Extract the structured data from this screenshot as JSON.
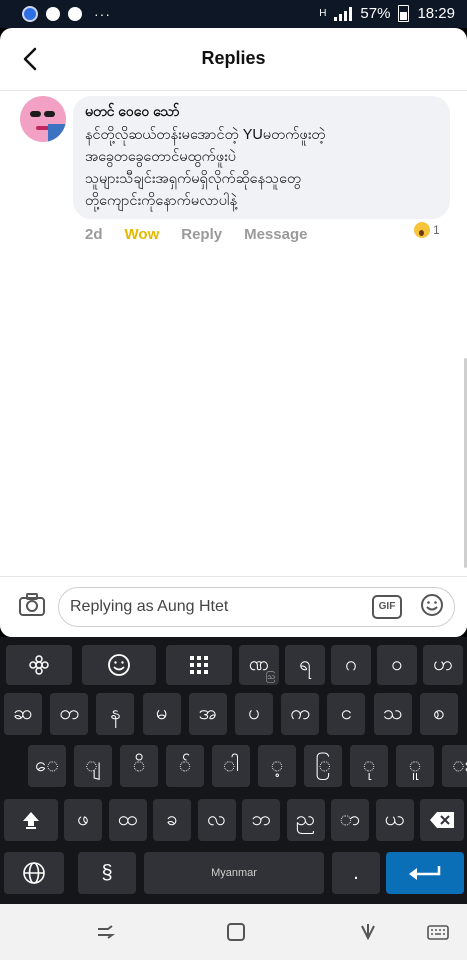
{
  "statusbar": {
    "battery": "57%",
    "time": "18:29",
    "dots": "···"
  },
  "header": {
    "title": "Replies"
  },
  "comment": {
    "author": "မတင် ဝေဝေ သော်",
    "lines": [
      "နင်တို့လိုဆယ်တန်းမအောင်တဲ့ YUမတက်ဖူးတဲ့",
      "အခွေတခွေတောင်မထွက်ဖူးပဲ",
      "သူများသီချင်းအရှက်မရှိလိုက်ဆိုနေသူတွေ",
      "တို့ကျောင်းကိုနောက်မလာပါနဲ့"
    ],
    "time": "2d",
    "reaction_label": "Wow",
    "reply_label": "Reply",
    "message_label": "Message",
    "reaction_count": "1"
  },
  "input": {
    "placeholder": "Replying as Aung Htet",
    "gif_label": "GIF"
  },
  "keyboard": {
    "row1": [
      "",
      "",
      "",
      "ဏ",
      "ရ",
      "ဂ",
      "ဝ",
      "ဟ"
    ],
    "row1_sub": [
      "",
      "",
      "",
      "ဩ",
      "",
      "",
      "",
      ""
    ],
    "row2": [
      "ဆ",
      "တ",
      "န",
      "မ",
      "အ",
      "ပ",
      "က",
      "င",
      "သ",
      "စ"
    ],
    "row3": [
      "ေ",
      "ျ",
      "ိ",
      "်",
      "ါ",
      "့",
      "ြ",
      "ု",
      "ူ",
      "း"
    ],
    "row4": [
      "ဖ",
      "ထ",
      "ခ",
      "လ",
      "ဘ",
      "ည",
      "ာ",
      "ယ"
    ],
    "space_label": "Myanmar",
    "period": ".",
    "symbol_key": "§",
    "colors": {
      "bg": "#15161a",
      "key": "#303237",
      "enter": "#0a6fb7"
    }
  }
}
